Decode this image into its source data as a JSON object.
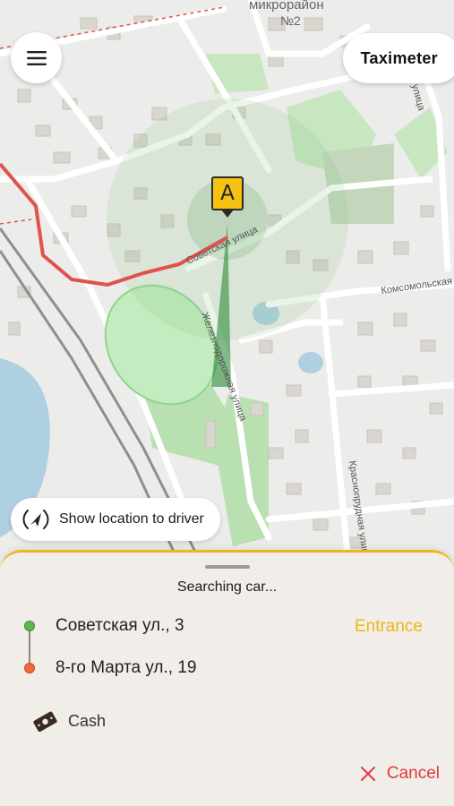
{
  "map": {
    "labels": {
      "district": "микрорайон",
      "district_no": "№2",
      "street_sovetskaya": "Советская улица",
      "street_komsomolskaya": "Комсомольская",
      "street_zheleznodorozhnaya": "Железнодорожная улица",
      "street_krasnoprudnaya": "Краснопрудная улица",
      "street_edge": "улица"
    },
    "pin_letter": "A",
    "colors": {
      "route": "#e0524a",
      "park": "#b9e0b0",
      "water": "#aed0e0"
    }
  },
  "header": {
    "menu_icon": "hamburger-menu-icon",
    "taximeter_label": "Taximeter"
  },
  "show_location": {
    "icon": "location-broadcast-icon",
    "label": "Show location to driver"
  },
  "order": {
    "status": "Searching car...",
    "pickup": "Советская ул., 3",
    "dropoff": "8-го Марта ул., 19",
    "entrance_label": "Entrance",
    "payment_icon": "cash-icon",
    "payment_label": "Cash",
    "cancel_icon": "close-icon",
    "cancel_label": "Cancel",
    "colors": {
      "accent": "#f0b51b",
      "cancel": "#e3383c",
      "pickup_dot": "#5cb84c",
      "dropoff_dot": "#ef6b3a"
    }
  }
}
